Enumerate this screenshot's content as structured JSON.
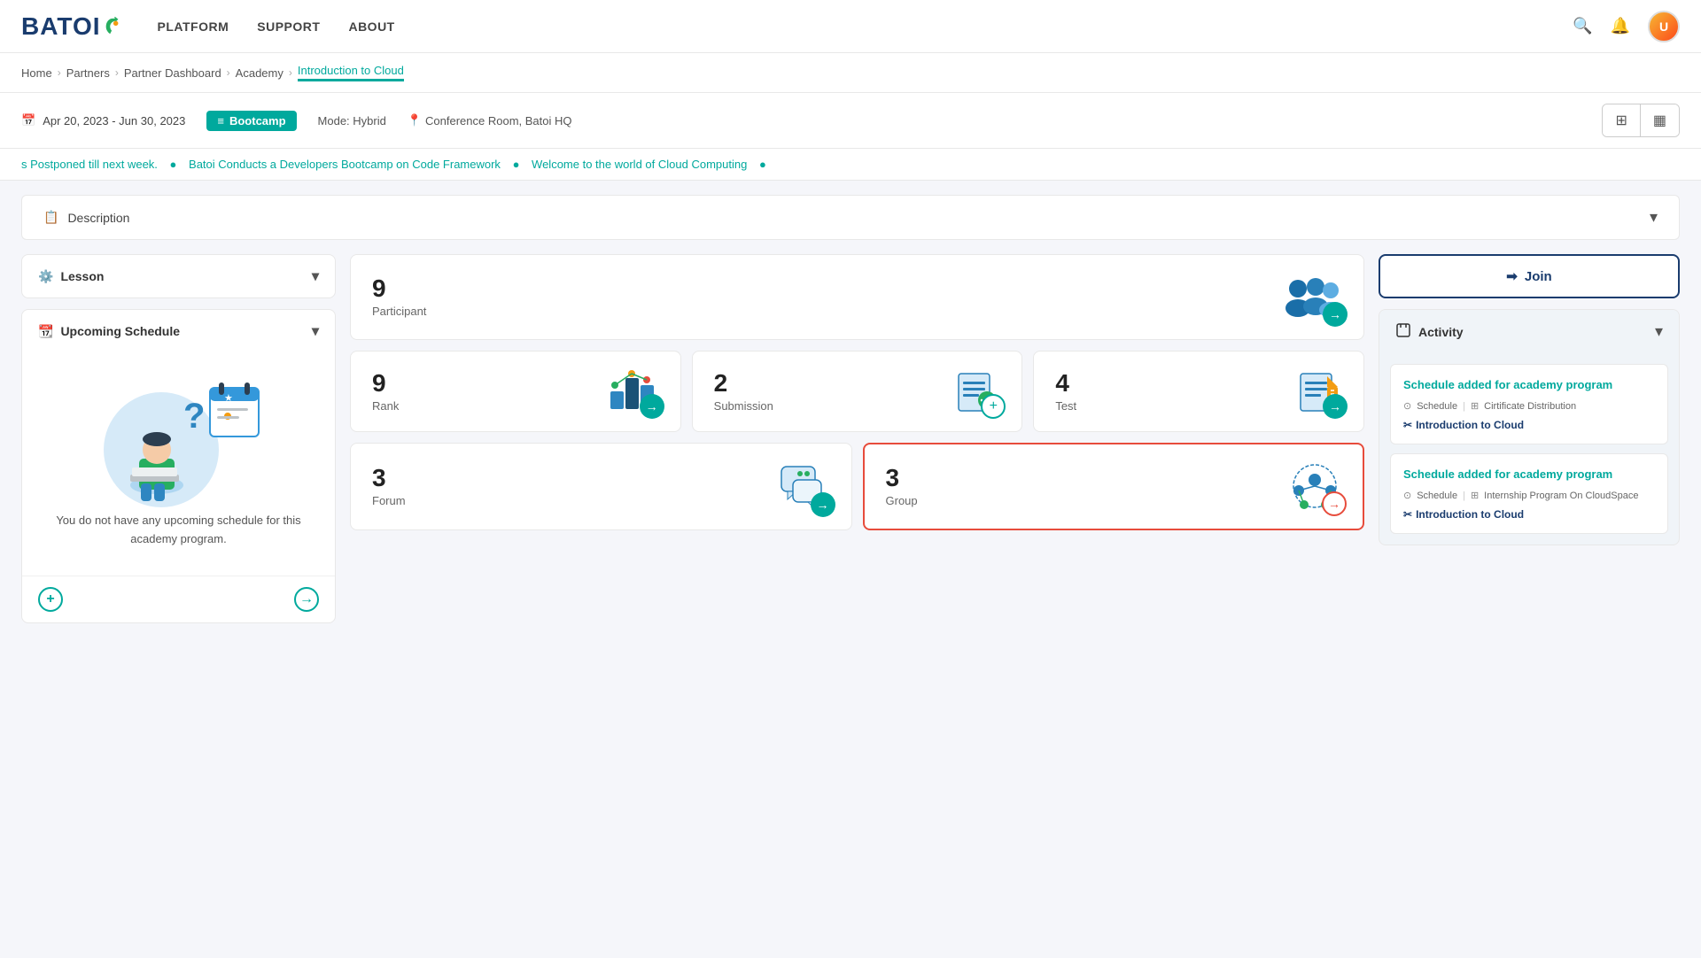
{
  "navbar": {
    "logo": "BATOI",
    "nav_items": [
      "PLATFORM",
      "SUPPORT",
      "ABOUT"
    ],
    "avatar_initials": "U"
  },
  "breadcrumb": {
    "items": [
      "Home",
      "Partners",
      "Partner Dashboard",
      "Academy",
      "Introduction to Cloud"
    ]
  },
  "date_bar": {
    "date_range": "Apr 20, 2023  -  Jun 30, 2023",
    "badge": "Bootcamp",
    "mode": "Mode: Hybrid",
    "location": "Conference Room, Batoi HQ"
  },
  "ticker": {
    "items": [
      "s Postponed till next week.",
      "Batoi Conducts a Developers Bootcamp on Code Framework",
      "Welcome to the world of Cloud Computing"
    ]
  },
  "description_section": {
    "label": "Description",
    "chevron": "▾"
  },
  "lesson_section": {
    "label": "Lesson",
    "chevron": "▾"
  },
  "upcoming_schedule": {
    "label": "Upcoming Schedule",
    "chevron": "▾",
    "empty_text": "You do not have any upcoming schedule for this academy program.",
    "add_label": "+",
    "arrow_label": "→"
  },
  "stats": {
    "participant": {
      "number": "9",
      "label": "Participant"
    },
    "rank": {
      "number": "9",
      "label": "Rank"
    },
    "submission": {
      "number": "2",
      "label": "Submission"
    },
    "test": {
      "number": "4",
      "label": "Test"
    },
    "forum": {
      "number": "3",
      "label": "Forum"
    },
    "group": {
      "number": "3",
      "label": "Group"
    }
  },
  "right_panel": {
    "join_button": "Join",
    "activity_label": "Activity",
    "activity_chevron": "▾",
    "activity_cards": [
      {
        "title": "Schedule added for academy program",
        "meta_icon1": "Schedule",
        "meta_icon2": "Cirtificate Distribution",
        "link": "Introduction to Cloud"
      },
      {
        "title": "Schedule added for academy program",
        "meta_icon1": "Schedule",
        "meta_icon2": "Internship Program On CloudSpace",
        "link": "Introduction to Cloud"
      }
    ]
  }
}
